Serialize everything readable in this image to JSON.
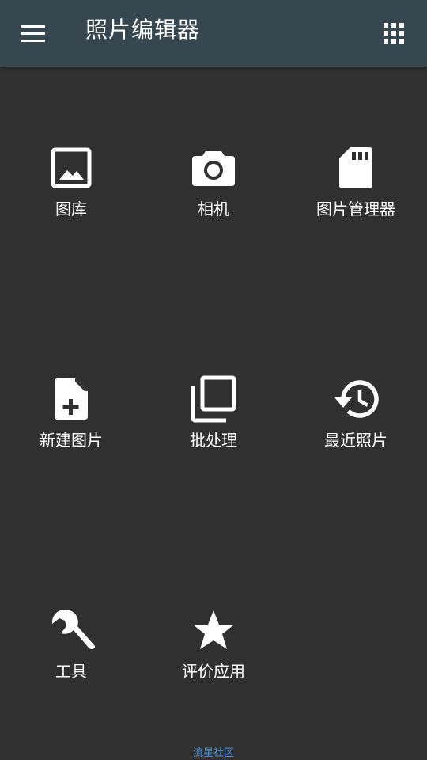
{
  "app": {
    "title": "照片编辑器"
  },
  "appbar": {
    "menu_icon": "hamburger-menu-icon",
    "apps_icon": "apps-grid-icon"
  },
  "tiles": [
    {
      "label": "图库",
      "icon": "image-icon"
    },
    {
      "label": "相机",
      "icon": "camera-icon"
    },
    {
      "label": "图片管理器",
      "icon": "sd-card-icon"
    },
    {
      "label": "新建图片",
      "icon": "new-file-icon"
    },
    {
      "label": "批处理",
      "icon": "stacked-pages-icon"
    },
    {
      "label": "最近照片",
      "icon": "history-icon"
    },
    {
      "label": "工具",
      "icon": "wrench-icon"
    },
    {
      "label": "评价应用",
      "icon": "star-icon"
    }
  ],
  "footer": {
    "text": "流星社区"
  },
  "colors": {
    "background": "#303030",
    "appbar": "#37474f",
    "icon": "#ffffff",
    "footer_link": "#4a90e2"
  }
}
